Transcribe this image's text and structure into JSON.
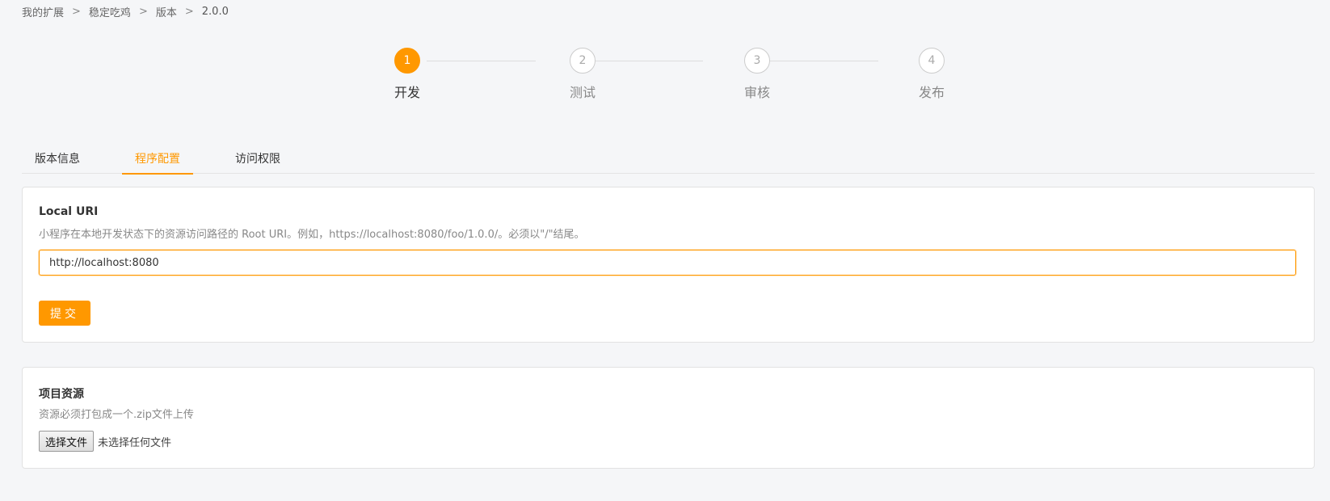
{
  "breadcrumb": {
    "items": [
      "我的扩展",
      "稳定吃鸡",
      "版本",
      "2.0.0"
    ],
    "separator": ">"
  },
  "steps": [
    {
      "number": "1",
      "label": "开发",
      "active": true
    },
    {
      "number": "2",
      "label": "测试",
      "active": false
    },
    {
      "number": "3",
      "label": "审核",
      "active": false
    },
    {
      "number": "4",
      "label": "发布",
      "active": false
    }
  ],
  "tabs": [
    {
      "label": "版本信息",
      "active": false
    },
    {
      "label": "程序配置",
      "active": true
    },
    {
      "label": "访问权限",
      "active": false
    }
  ],
  "local_uri": {
    "title": "Local URI",
    "description": "小程序在本地开发状态下的资源访问路径的 Root URI。例如，https://localhost:8080/foo/1.0.0/。必须以\"/\"结尾。",
    "value": "http://localhost:8080",
    "submit_label": "提交"
  },
  "resources": {
    "title": "项目资源",
    "description": "资源必须打包成一个.zip文件上传",
    "file_button_label": "选择文件",
    "file_status": "未选择任何文件"
  },
  "colors": {
    "accent": "#ff9800",
    "background": "#f5f6f8"
  }
}
